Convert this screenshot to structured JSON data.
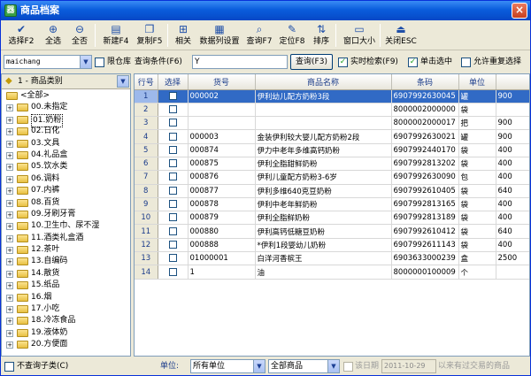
{
  "window": {
    "title": "商品档案",
    "app_icon": "app-icon",
    "close_label": "×"
  },
  "toolbar": [
    {
      "id": "select",
      "label": "选择F2",
      "icon": "check-icon",
      "glyph": "✔"
    },
    {
      "id": "select-all",
      "label": "全选",
      "icon": "zoom-in-icon",
      "glyph": "⊕"
    },
    {
      "id": "deselect-all",
      "label": "全否",
      "icon": "zoom-out-icon",
      "glyph": "⊖"
    },
    {
      "id": "new",
      "label": "新建F4",
      "icon": "new-doc-icon",
      "glyph": "▤"
    },
    {
      "id": "copy",
      "label": "复制F5",
      "icon": "copy-icon",
      "glyph": "❐"
    },
    {
      "id": "related",
      "label": "相关",
      "icon": "tree-icon",
      "glyph": "⊞"
    },
    {
      "id": "column-settings",
      "label": "数据列设置",
      "icon": "columns-icon",
      "glyph": "▦"
    },
    {
      "id": "query",
      "label": "查询F7",
      "icon": "search-doc-icon",
      "glyph": "⌕"
    },
    {
      "id": "locate",
      "label": "定位F8",
      "icon": "pencil-icon",
      "glyph": "✎"
    },
    {
      "id": "sort",
      "label": "排序",
      "icon": "sort-icon",
      "glyph": "⇅"
    },
    {
      "id": "window-size",
      "label": "窗口大小",
      "icon": "window-icon",
      "glyph": "▭"
    },
    {
      "id": "close",
      "label": "关闭ESC",
      "icon": "exit-icon",
      "glyph": "⏏"
    }
  ],
  "search": {
    "user_value": "maichang",
    "limit_warehouse_label": "限仓库",
    "query_condition_label": "查询条件(F6)",
    "query_value": "Y",
    "query_button": "查询(F3)",
    "realtime_label": "实时检索(F9)",
    "realtime_checked": true,
    "click_select_label": "单击选中",
    "click_select_checked": true,
    "allow_dup_label": "允许重复选择",
    "allow_dup_checked": false
  },
  "category": {
    "header": "1 - 商品类别",
    "items": [
      {
        "name": "<全部>",
        "root": true
      },
      {
        "name": "00.未指定"
      },
      {
        "name": "01.奶粉",
        "selected": true
      },
      {
        "name": "02.日化"
      },
      {
        "name": "03.文具"
      },
      {
        "name": "04.礼品盒"
      },
      {
        "name": "05.饮水类"
      },
      {
        "name": "06.调料"
      },
      {
        "name": "07.内裤"
      },
      {
        "name": "08.百货"
      },
      {
        "name": "09.牙刷牙膏"
      },
      {
        "name": "10.卫生巾、尿不湿"
      },
      {
        "name": "11.酒类礼盒酒"
      },
      {
        "name": "12.茶叶"
      },
      {
        "name": "13.自编码"
      },
      {
        "name": "14.散货"
      },
      {
        "name": "15.纸品"
      },
      {
        "name": "16.烟"
      },
      {
        "name": "17.小吃"
      },
      {
        "name": "18.冷冻食品"
      },
      {
        "name": "19.液体奶"
      },
      {
        "name": "20.方便面"
      }
    ]
  },
  "table": {
    "columns": [
      "行号",
      "选择",
      "货号",
      "商品名称",
      "条码",
      "单位",
      ""
    ],
    "rows": [
      {
        "rn": "1",
        "code": "000002",
        "name": "伊利幼儿配方奶粉3段",
        "barcode": "6907992630045",
        "unit": "罐",
        "extra": "900",
        "selected": true
      },
      {
        "rn": "2",
        "code": "",
        "name": "",
        "barcode": "8000002000000",
        "unit": "袋",
        "extra": ""
      },
      {
        "rn": "3",
        "code": "",
        "name": "",
        "barcode": "8000002000017",
        "unit": "把",
        "extra": "900"
      },
      {
        "rn": "4",
        "code": "000003",
        "name": "金装伊利较大婴儿配方奶粉2段",
        "barcode": "6907992630021",
        "unit": "罐",
        "extra": "900"
      },
      {
        "rn": "5",
        "code": "000874",
        "name": "伊力中老年多维高钙奶粉",
        "barcode": "6907992440170",
        "unit": "袋",
        "extra": "400"
      },
      {
        "rn": "6",
        "code": "000875",
        "name": "伊利全脂甜鲜奶粉",
        "barcode": "6907992813202",
        "unit": "袋",
        "extra": "400"
      },
      {
        "rn": "7",
        "code": "000876",
        "name": "伊利儿童配方奶粉3-6岁",
        "barcode": "6907992630090",
        "unit": "包",
        "extra": "400"
      },
      {
        "rn": "8",
        "code": "000877",
        "name": "伊利多维640克豆奶粉",
        "barcode": "6907992610405",
        "unit": "袋",
        "extra": "640"
      },
      {
        "rn": "9",
        "code": "000878",
        "name": "伊利中老年鲜奶粉",
        "barcode": "6907992813165",
        "unit": "袋",
        "extra": "400"
      },
      {
        "rn": "10",
        "code": "000879",
        "name": "伊利全脂鲜奶粉",
        "barcode": "6907992813189",
        "unit": "袋",
        "extra": "400"
      },
      {
        "rn": "11",
        "code": "000880",
        "name": "伊利高钙低糖豆奶粉",
        "barcode": "6907992610412",
        "unit": "袋",
        "extra": "640"
      },
      {
        "rn": "12",
        "code": "000888",
        "name": "*伊利1段婴幼儿奶粉",
        "barcode": "6907992611143",
        "unit": "袋",
        "extra": "400"
      },
      {
        "rn": "13",
        "code": "01000001",
        "name": "白洋河香槟王",
        "barcode": "6903633000239",
        "unit": "盒",
        "extra": "2500"
      },
      {
        "rn": "14",
        "code": "1",
        "name": "油",
        "barcode": "8000000100009",
        "unit": "个",
        "extra": ""
      }
    ]
  },
  "bottom": {
    "no_subcategory_label": "不查询子类(C)",
    "unit_label": "单位:",
    "unit_value": "所有单位",
    "goods_value": "全部商品",
    "date_label": "该日期",
    "date_value": "2011-10-29",
    "date_suffix": "以来有过交易的商品"
  }
}
